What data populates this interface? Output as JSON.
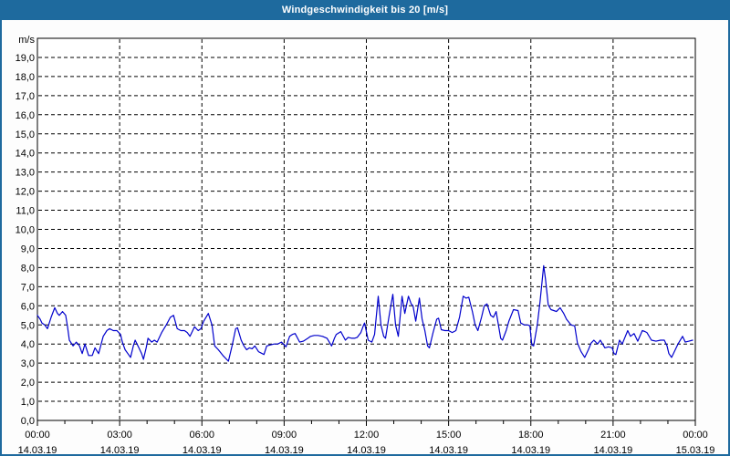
{
  "window": {
    "title": "Windgeschwindigkeit bis 20 [m/s]"
  },
  "colors": {
    "titlebar_bg": "#1e6a9e",
    "window_border": "#1e6a9e",
    "series_line": "#0000cc",
    "grid": "#000000",
    "frame": "#000000",
    "plot_bg": "#ffffff",
    "text": "#000000",
    "title_text": "#ffffff"
  },
  "chart_data": {
    "type": "line",
    "title": "Windgeschwindigkeit bis 20 [m/s]",
    "y_unit_label": "m/s",
    "ylim": [
      0,
      20
    ],
    "ytick_step": 1.0,
    "ytick_labels": [
      "0,0",
      "1,0",
      "2,0",
      "3,0",
      "4,0",
      "5,0",
      "6,0",
      "7,0",
      "8,0",
      "9,0",
      "10,0",
      "11,0",
      "12,0",
      "13,0",
      "14,0",
      "15,0",
      "16,0",
      "17,0",
      "18,0",
      "19,0"
    ],
    "x_range_minutes": [
      0,
      1440
    ],
    "minor_xtick_every_hours": 1,
    "major_xtick_every_hours": 3,
    "grid_style": "dashed",
    "legend": "none",
    "xticks": [
      {
        "hour": 0,
        "time": "00:00",
        "date": "14.03.19"
      },
      {
        "hour": 3,
        "time": "03:00",
        "date": "14.03.19"
      },
      {
        "hour": 6,
        "time": "06:00",
        "date": "14.03.19"
      },
      {
        "hour": 9,
        "time": "09:00",
        "date": "14.03.19"
      },
      {
        "hour": 12,
        "time": "12:00",
        "date": "14.03.19"
      },
      {
        "hour": 15,
        "time": "15:00",
        "date": "14.03.19"
      },
      {
        "hour": 18,
        "time": "18:00",
        "date": "14.03.19"
      },
      {
        "hour": 21,
        "time": "21:00",
        "date": "14.03.19"
      },
      {
        "hour": 24,
        "time": "00:00",
        "date": "15.03.19"
      }
    ],
    "series": [
      {
        "name": "Windgeschwindigkeit",
        "color": "#0000cc",
        "points": [
          [
            0,
            5.5
          ],
          [
            6,
            5.3
          ],
          [
            10,
            5.1
          ],
          [
            16,
            5.0
          ],
          [
            22,
            4.8
          ],
          [
            30,
            5.4
          ],
          [
            38,
            5.9
          ],
          [
            44,
            5.6
          ],
          [
            48,
            5.5
          ],
          [
            55,
            5.7
          ],
          [
            62,
            5.5
          ],
          [
            66,
            4.9
          ],
          [
            70,
            4.2
          ],
          [
            78,
            3.9
          ],
          [
            85,
            4.1
          ],
          [
            92,
            3.9
          ],
          [
            98,
            3.5
          ],
          [
            104,
            4.0
          ],
          [
            112,
            3.4
          ],
          [
            120,
            3.4
          ],
          [
            126,
            3.8
          ],
          [
            134,
            3.5
          ],
          [
            144,
            4.4
          ],
          [
            152,
            4.7
          ],
          [
            158,
            4.8
          ],
          [
            166,
            4.7
          ],
          [
            174,
            4.7
          ],
          [
            182,
            4.5
          ],
          [
            186,
            4.1
          ],
          [
            192,
            3.7
          ],
          [
            198,
            3.5
          ],
          [
            204,
            3.3
          ],
          [
            210,
            3.9
          ],
          [
            214,
            4.2
          ],
          [
            222,
            3.8
          ],
          [
            228,
            3.5
          ],
          [
            232,
            3.2
          ],
          [
            238,
            3.8
          ],
          [
            242,
            4.3
          ],
          [
            250,
            4.1
          ],
          [
            256,
            4.2
          ],
          [
            262,
            4.1
          ],
          [
            272,
            4.6
          ],
          [
            282,
            5.0
          ],
          [
            291,
            5.4
          ],
          [
            298,
            5.5
          ],
          [
            306,
            4.8
          ],
          [
            314,
            4.7
          ],
          [
            322,
            4.7
          ],
          [
            328,
            4.6
          ],
          [
            334,
            4.4
          ],
          [
            344,
            4.9
          ],
          [
            352,
            4.7
          ],
          [
            358,
            4.8
          ],
          [
            364,
            5.2
          ],
          [
            374,
            5.6
          ],
          [
            382,
            5.0
          ],
          [
            388,
            3.9
          ],
          [
            396,
            3.7
          ],
          [
            406,
            3.4
          ],
          [
            414,
            3.2
          ],
          [
            418,
            3.1
          ],
          [
            426,
            3.9
          ],
          [
            434,
            4.8
          ],
          [
            438,
            4.85
          ],
          [
            446,
            4.2
          ],
          [
            452,
            3.9
          ],
          [
            458,
            3.7
          ],
          [
            464,
            3.8
          ],
          [
            470,
            3.75
          ],
          [
            476,
            3.9
          ],
          [
            484,
            3.6
          ],
          [
            492,
            3.5
          ],
          [
            496,
            3.45
          ],
          [
            502,
            3.9
          ],
          [
            510,
            3.95
          ],
          [
            518,
            4.0
          ],
          [
            526,
            4.0
          ],
          [
            534,
            4.1
          ],
          [
            544,
            3.85
          ],
          [
            552,
            4.4
          ],
          [
            558,
            4.5
          ],
          [
            564,
            4.55
          ],
          [
            574,
            4.1
          ],
          [
            582,
            4.15
          ],
          [
            592,
            4.3
          ],
          [
            598,
            4.4
          ],
          [
            606,
            4.45
          ],
          [
            614,
            4.45
          ],
          [
            624,
            4.4
          ],
          [
            634,
            4.3
          ],
          [
            644,
            3.9
          ],
          [
            650,
            4.3
          ],
          [
            654,
            4.5
          ],
          [
            664,
            4.65
          ],
          [
            674,
            4.2
          ],
          [
            680,
            4.35
          ],
          [
            688,
            4.3
          ],
          [
            694,
            4.3
          ],
          [
            700,
            4.35
          ],
          [
            708,
            4.6
          ],
          [
            714,
            5.0
          ],
          [
            716,
            5.1
          ],
          [
            724,
            4.2
          ],
          [
            732,
            4.1
          ],
          [
            738,
            4.5
          ],
          [
            746,
            6.5
          ],
          [
            752,
            5.0
          ],
          [
            758,
            4.4
          ],
          [
            762,
            4.3
          ],
          [
            770,
            5.5
          ],
          [
            778,
            6.6
          ],
          [
            784,
            5.0
          ],
          [
            790,
            4.4
          ],
          [
            798,
            6.5
          ],
          [
            804,
            5.6
          ],
          [
            812,
            6.5
          ],
          [
            818,
            6.1
          ],
          [
            822,
            6.0
          ],
          [
            828,
            5.2
          ],
          [
            836,
            6.4
          ],
          [
            842,
            5.3
          ],
          [
            848,
            4.7
          ],
          [
            854,
            3.9
          ],
          [
            858,
            3.8
          ],
          [
            866,
            4.6
          ],
          [
            874,
            5.3
          ],
          [
            878,
            5.35
          ],
          [
            884,
            4.75
          ],
          [
            892,
            4.7
          ],
          [
            900,
            4.7
          ],
          [
            908,
            4.6
          ],
          [
            916,
            4.7
          ],
          [
            924,
            5.4
          ],
          [
            932,
            6.5
          ],
          [
            938,
            6.4
          ],
          [
            944,
            6.45
          ],
          [
            952,
            5.7
          ],
          [
            958,
            5.0
          ],
          [
            964,
            4.7
          ],
          [
            972,
            5.4
          ],
          [
            978,
            6.0
          ],
          [
            984,
            6.1
          ],
          [
            992,
            5.5
          ],
          [
            998,
            5.4
          ],
          [
            1004,
            5.7
          ],
          [
            1014,
            4.3
          ],
          [
            1018,
            4.2
          ],
          [
            1026,
            4.7
          ],
          [
            1032,
            5.2
          ],
          [
            1042,
            5.8
          ],
          [
            1052,
            5.75
          ],
          [
            1058,
            5.1
          ],
          [
            1066,
            5.0
          ],
          [
            1074,
            5.0
          ],
          [
            1078,
            4.95
          ],
          [
            1082,
            3.95
          ],
          [
            1086,
            3.9
          ],
          [
            1094,
            5.0
          ],
          [
            1100,
            6.2
          ],
          [
            1108,
            8.1
          ],
          [
            1112,
            7.4
          ],
          [
            1118,
            6.05
          ],
          [
            1124,
            5.8
          ],
          [
            1130,
            5.75
          ],
          [
            1136,
            5.7
          ],
          [
            1144,
            5.9
          ],
          [
            1152,
            5.6
          ],
          [
            1158,
            5.3
          ],
          [
            1168,
            5.0
          ],
          [
            1176,
            4.95
          ],
          [
            1182,
            4.05
          ],
          [
            1190,
            3.6
          ],
          [
            1198,
            3.3
          ],
          [
            1206,
            3.7
          ],
          [
            1212,
            4.05
          ],
          [
            1218,
            4.2
          ],
          [
            1226,
            4.0
          ],
          [
            1232,
            4.2
          ],
          [
            1242,
            3.8
          ],
          [
            1250,
            3.85
          ],
          [
            1258,
            3.8
          ],
          [
            1262,
            3.5
          ],
          [
            1266,
            3.45
          ],
          [
            1274,
            4.2
          ],
          [
            1280,
            4.0
          ],
          [
            1292,
            4.7
          ],
          [
            1298,
            4.4
          ],
          [
            1306,
            4.55
          ],
          [
            1314,
            4.15
          ],
          [
            1324,
            4.7
          ],
          [
            1330,
            4.65
          ],
          [
            1334,
            4.6
          ],
          [
            1344,
            4.2
          ],
          [
            1354,
            4.15
          ],
          [
            1364,
            4.2
          ],
          [
            1372,
            4.2
          ],
          [
            1378,
            3.9
          ],
          [
            1382,
            3.5
          ],
          [
            1388,
            3.3
          ],
          [
            1396,
            3.7
          ],
          [
            1402,
            4.0
          ],
          [
            1412,
            4.4
          ],
          [
            1418,
            4.1
          ],
          [
            1426,
            4.15
          ],
          [
            1434,
            4.2
          ]
        ]
      }
    ]
  }
}
